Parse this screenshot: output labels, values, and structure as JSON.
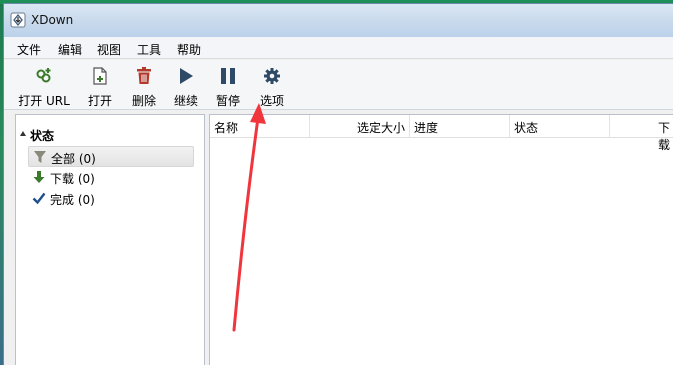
{
  "window": {
    "title": "XDown"
  },
  "menu": {
    "items": [
      "文件",
      "编辑",
      "视图",
      "工具",
      "帮助"
    ]
  },
  "toolbar": {
    "buttons": [
      {
        "label": "打开 URL",
        "icon": "open-url-icon"
      },
      {
        "label": "打开",
        "icon": "open-file-icon"
      },
      {
        "label": "删除",
        "icon": "trash-icon"
      },
      {
        "label": "继续",
        "icon": "play-icon"
      },
      {
        "label": "暂停",
        "icon": "pause-icon"
      },
      {
        "label": "选项",
        "icon": "gear-icon"
      }
    ]
  },
  "tree": {
    "header": "状态",
    "items": [
      {
        "label": "全部 (0)",
        "icon": "filter-icon",
        "selected": true
      },
      {
        "label": "下载 (0)",
        "icon": "download-arrow-icon",
        "selected": false
      },
      {
        "label": "完成 (0)",
        "icon": "checkmark-icon",
        "selected": false
      }
    ]
  },
  "list": {
    "columns": [
      "名称",
      "选定大小",
      "进度",
      "状态",
      "下载"
    ]
  },
  "colors": {
    "titlebar": "#c7d9ec",
    "annotation_arrow": "#f0353d",
    "download_green": "#3a7a2a",
    "check_blue": "#1e4f8a",
    "trash_red": "#b23a2c"
  }
}
